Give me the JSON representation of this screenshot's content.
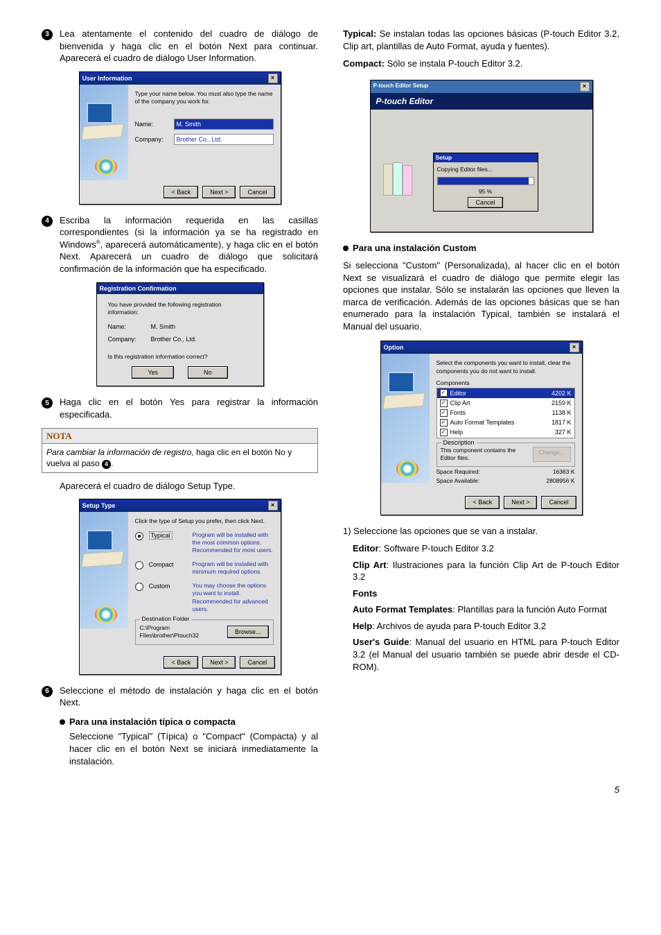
{
  "page_number": "5",
  "left": {
    "step3": "Lea atentamente el contenido del cuadro de diálogo de bienvenida y haga clic en el botón Next para continuar. Aparecerá el cuadro de diálogo User Information.",
    "step4_a": "Escriba la información requerida en las casillas correspondientes (si la información ya se ha registrado en Windows",
    "step4_b": ", aparecerá automáticamente), y haga clic en el botón Next. Aparecerá un cuadro de diálogo que solicitará confirmación de la información que ha especificado.",
    "step5": "Haga clic en el botón Yes para registrar la información especificada.",
    "note_title": "NOTA",
    "note_body_i": "Para cambiar la información de registro,",
    "note_body_n": " haga clic en el botón No y vuelva al paso ",
    "note_body_end": ".",
    "after_note": "Aparecerá el cuadro de diálogo Setup Type.",
    "step6": "Seleccione el método de instalación y haga clic en el botón Next.",
    "sub_bullet": "Para una instalación típica o compacta",
    "sub_text": "Seleccione \"Typical\" (Típica) o \"Compact\" (Compacta) y al hacer clic en el botón Next se iniciará inmediatamente la instalación."
  },
  "right": {
    "typical_label": "Typical:",
    "typical_text": " Se instalan todas las opciones básicas (P-touch Editor 3.2, Clip art, plantillas de Auto Format, ayuda y fuentes).",
    "compact_label": "Compact:",
    "compact_text": " Sólo se instala P-touch Editor 3.2.",
    "custom_bullet": "Para una instalación Custom",
    "custom_text": "Si selecciona \"Custom\" (Personalizada), al hacer clic en el botón Next se visualizará el cuadro de diálogo que permite elegir las opciones que instalar. Sólo se instalarán las opciones que lleven la marca de verificación. Además de las opciones básicas que se han enumerado para la instalación Typical, también se instalará el Manual del usuario.",
    "list_intro": "1) Seleccione las opciones que se van a instalar.",
    "items": {
      "editor_l": "Editor",
      "editor_t": ": Software P-touch Editor 3.2",
      "clip_l": "Clip Art",
      "clip_t": ": Ilustraciones para la función Clip Art de P-touch Editor 3.2",
      "fonts_l": "Fonts",
      "aft_l": "Auto Format Templates",
      "aft_t": ": Plantillas para la función Auto Format",
      "help_l": "Help",
      "help_t": ": Archivos de ayuda para P-touch Editor 3.2",
      "ug_l": "User's Guide",
      "ug_t": ": Manual del usuario en HTML para P-touch Editor 3.2 (el Manual del usuario también se puede abrir desde el CD-ROM)."
    }
  },
  "shot_user": {
    "title": "User Information",
    "intro": "Type your name below. You must also type the name of the company you work for.",
    "name_l": "Name:",
    "name_v": "M. Smith",
    "comp_l": "Company:",
    "comp_v": "Brother Co., Ltd.",
    "back": "< Back",
    "next": "Next >",
    "cancel": "Cancel"
  },
  "shot_reg": {
    "title": "Registration Confirmation",
    "intro": "You have provided the following registration information:",
    "name_l": "Name:",
    "name_v": "M. Smith",
    "comp_l": "Company:",
    "comp_v": "Brother Co., Ltd.",
    "q": "Is this registration information correct?",
    "yes": "Yes",
    "no": "No"
  },
  "shot_setup": {
    "title": "Setup Type",
    "intro": "Click the type of Setup you prefer, then click Next.",
    "typical": "Typical",
    "typical_d": "Program will be installed with the most common options. Recommended for most users.",
    "compact": "Compact",
    "compact_d": "Program will be installed with minimum required options.",
    "custom": "Custom",
    "custom_d": "You may choose the options you want to install. Recommended for advanced users.",
    "dest_legend": "Destination Folder",
    "dest_path": "C:\\Program Files\\brother\\Ptouch32",
    "browse": "Browse...",
    "back": "< Back",
    "next": "Next >",
    "cancel": "Cancel"
  },
  "shot_progress": {
    "window": "P-touch Editor Setup",
    "brand": "P-touch Editor",
    "dlg_title": "Setup",
    "msg": "Copying Editor files...",
    "pct": "95 %",
    "cancel": "Cancel"
  },
  "shot_option": {
    "title": "Option",
    "intro": "Select the components you want to install, clear the components you do not want to install.",
    "components": "Components",
    "rows": [
      {
        "n": "Editor",
        "s": "4202 K"
      },
      {
        "n": "Clip Art",
        "s": "2159 K"
      },
      {
        "n": "Fonts",
        "s": "1138 K"
      },
      {
        "n": "Auto Format Templates",
        "s": "1817 K"
      },
      {
        "n": "Help",
        "s": "327 K"
      }
    ],
    "desc_legend": "Description",
    "desc_text": "This component contains the Editor files.",
    "change": "Change...",
    "req_l": "Space Required:",
    "req_v": "16363 K",
    "avl_l": "Space Available:",
    "avl_v": "2808956 K",
    "back": "< Back",
    "next": "Next >",
    "cancel": "Cancel"
  }
}
